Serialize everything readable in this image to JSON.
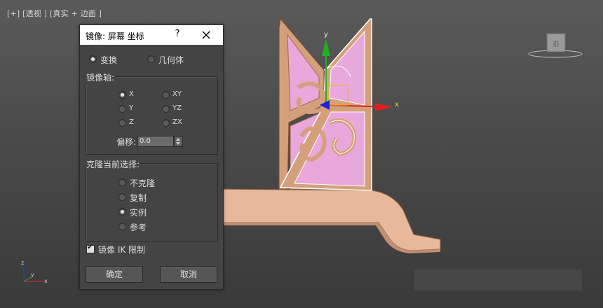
{
  "viewport": {
    "label": "[+] [透视 ] [真实 + 边面 ]",
    "gizmo_axes": {
      "x": "x",
      "y": "y"
    },
    "axis_tripod": {
      "x": "x",
      "y": "y",
      "z": "z"
    }
  },
  "dialog": {
    "title": "镜像: 屏幕 坐标",
    "help": "?",
    "mode_options": [
      {
        "label": "变换",
        "checked": true
      },
      {
        "label": "几何体",
        "checked": false
      }
    ],
    "mirror_axis": {
      "title": "镜像轴:",
      "options": [
        {
          "label": "X",
          "checked": true
        },
        {
          "label": "Y",
          "checked": false
        },
        {
          "label": "Z",
          "checked": false
        },
        {
          "label": "XY",
          "checked": false
        },
        {
          "label": "YZ",
          "checked": false
        },
        {
          "label": "ZX",
          "checked": false
        }
      ],
      "offset_label": "偏移:",
      "offset_value": "0.0"
    },
    "clone": {
      "title": "克隆当前选择:",
      "options": [
        {
          "label": "不克隆",
          "checked": false
        },
        {
          "label": "复制",
          "checked": false
        },
        {
          "label": "实例",
          "checked": true
        },
        {
          "label": "参考",
          "checked": false
        }
      ]
    },
    "ik_label": "镜像 IK 限制",
    "ik_checked": true,
    "ok_label": "确定",
    "cancel_label": "取消"
  },
  "colors": {
    "panel_fill": "#e8a8dc",
    "wood": "#d4a07c",
    "selection": "#ffffff",
    "axis_x": "#e02020",
    "axis_y": "#20b020",
    "axis_z": "#2020e0"
  }
}
